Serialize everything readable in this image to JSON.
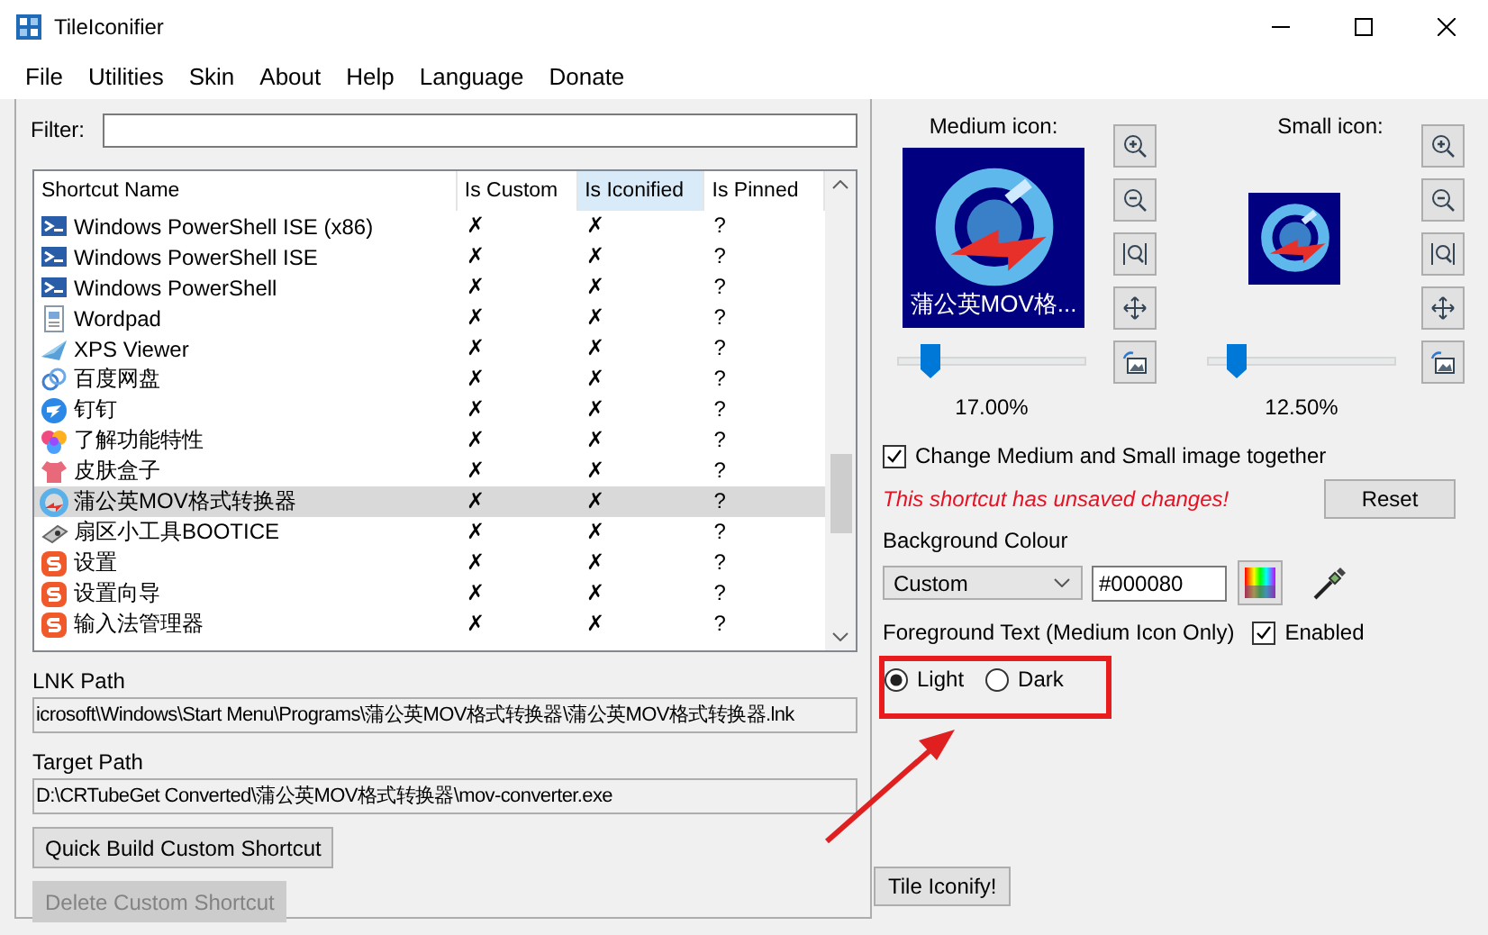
{
  "window": {
    "title": "TileIconifier"
  },
  "menu": [
    "File",
    "Utilities",
    "Skin",
    "About",
    "Help",
    "Language",
    "Donate"
  ],
  "filter": {
    "label": "Filter:"
  },
  "table": {
    "columns": [
      {
        "label": "Shortcut Name",
        "selected": false
      },
      {
        "label": "Is Custom",
        "selected": false
      },
      {
        "label": "Is Iconified",
        "selected": true
      },
      {
        "label": "Is Pinned",
        "selected": false
      }
    ],
    "rows": [
      {
        "kind": "terminal",
        "name": "Windows PowerShell ISE (x86)",
        "is_custom": "✗",
        "is_iconified": "✗",
        "is_pinned": "?",
        "selected": false
      },
      {
        "kind": "terminal",
        "name": "Windows PowerShell ISE",
        "is_custom": "✗",
        "is_iconified": "✗",
        "is_pinned": "?",
        "selected": false
      },
      {
        "kind": "terminal",
        "name": "Windows PowerShell",
        "is_custom": "✗",
        "is_iconified": "✗",
        "is_pinned": "?",
        "selected": false
      },
      {
        "kind": "document",
        "name": "Wordpad",
        "is_custom": "✗",
        "is_iconified": "✗",
        "is_pinned": "?",
        "selected": false
      },
      {
        "kind": "plane",
        "name": "XPS Viewer",
        "is_custom": "✗",
        "is_iconified": "✗",
        "is_pinned": "?",
        "selected": false
      },
      {
        "kind": "cloud",
        "name": "百度网盘",
        "is_custom": "✗",
        "is_iconified": "✗",
        "is_pinned": "?",
        "selected": false
      },
      {
        "kind": "bird",
        "name": "钉钉",
        "is_custom": "✗",
        "is_iconified": "✗",
        "is_pinned": "?",
        "selected": false
      },
      {
        "kind": "petals",
        "name": "了解功能特性",
        "is_custom": "✗",
        "is_iconified": "✗",
        "is_pinned": "?",
        "selected": false
      },
      {
        "kind": "shirt",
        "name": "皮肤盒子",
        "is_custom": "✗",
        "is_iconified": "✗",
        "is_pinned": "?",
        "selected": false
      },
      {
        "kind": "converter",
        "name": "蒲公英MOV格式转换器",
        "is_custom": "✗",
        "is_iconified": "✗",
        "is_pinned": "?",
        "selected": true
      },
      {
        "kind": "drive",
        "name": "扇区小工具BOOTICE",
        "is_custom": "✗",
        "is_iconified": "✗",
        "is_pinned": "?",
        "selected": false
      },
      {
        "kind": "sogou",
        "name": "设置",
        "is_custom": "✗",
        "is_iconified": "✗",
        "is_pinned": "?",
        "selected": false
      },
      {
        "kind": "sogou",
        "name": "设置向导",
        "is_custom": "✗",
        "is_iconified": "✗",
        "is_pinned": "?",
        "selected": false
      },
      {
        "kind": "sogou",
        "name": "输入法管理器",
        "is_custom": "✗",
        "is_iconified": "✗",
        "is_pinned": "?",
        "selected": false
      }
    ]
  },
  "lnk_path": {
    "label": "LNK Path",
    "value": "icrosoft\\Windows\\Start Menu\\Programs\\蒲公英MOV格式转换器\\蒲公英MOV格式转换器.lnk"
  },
  "target_path": {
    "label": "Target Path",
    "value": "D:\\CRTubeGet Converted\\蒲公英MOV格式转换器\\mov-converter.exe"
  },
  "left_buttons": [
    {
      "label": "Quick Build Custom Shortcut",
      "disabled": false
    },
    {
      "label": "Delete Custom Shortcut",
      "disabled": true
    }
  ],
  "medium_icon": {
    "label": "Medium icon:",
    "caption": "蒲公英MOV格...",
    "level": 0.17,
    "reading": "17.00%"
  },
  "small_icon": {
    "label": "Small icon:",
    "level": 0.15,
    "reading": "12.50%"
  },
  "change_together": {
    "label": "Change Medium and Small image together",
    "checked": true
  },
  "warning": "This shortcut has unsaved changes!",
  "reset_button": "Reset",
  "background": {
    "label": "Background Colour",
    "mode": "Custom",
    "value": "#000080"
  },
  "foreground": {
    "label": "Foreground Text (Medium Icon Only)",
    "enabled": {
      "label": "Enabled",
      "checked": true
    },
    "options": [
      {
        "label": "Light",
        "selected": true
      },
      {
        "label": "Dark",
        "selected": false
      }
    ]
  },
  "tile_button": "Tile Iconify!"
}
